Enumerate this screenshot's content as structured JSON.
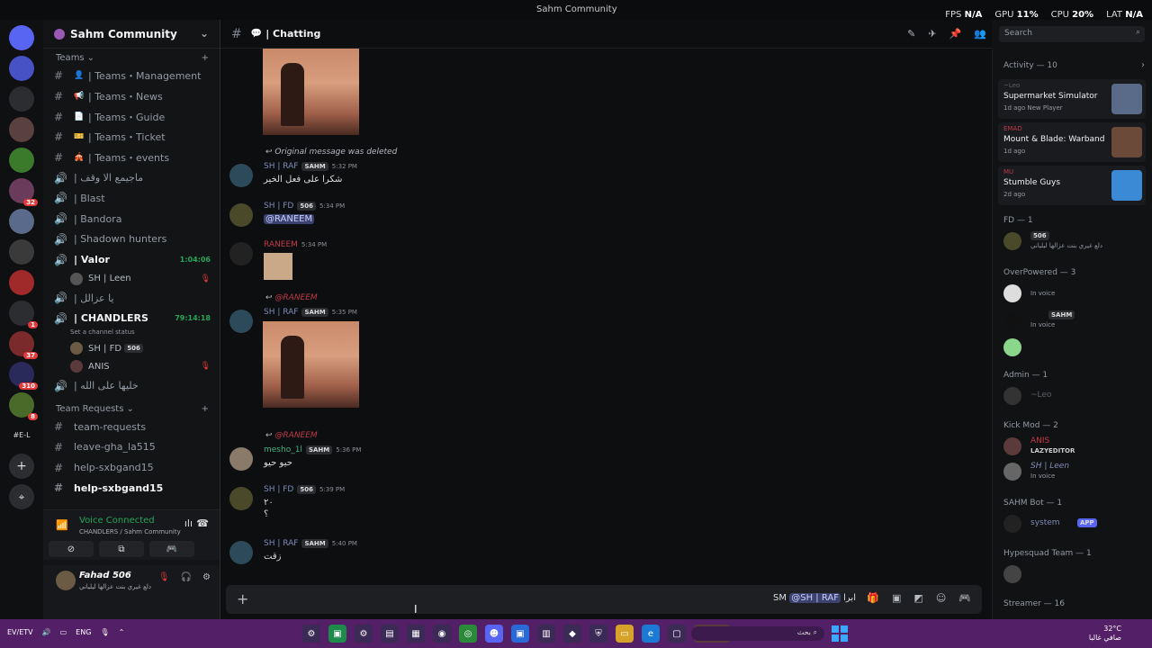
{
  "window": {
    "title": "Sahm Community",
    "fps_label": "FPS",
    "fps": "N/A",
    "gpu_label": "GPU",
    "gpu": "11%",
    "cpu_label": "CPU",
    "cpu": "20%",
    "lat_label": "LAT",
    "lat": "N/A"
  },
  "guild_badges": [
    "32",
    "1",
    "37",
    "310",
    "8"
  ],
  "guild_text": "#E-L",
  "server": {
    "name": "Sahm Community"
  },
  "channels": {
    "teams_cat": "Teams",
    "teams_items": [
      {
        "icon": "👤",
        "label": "| Teams・Management"
      },
      {
        "icon": "📢",
        "label": "| Teams・News"
      },
      {
        "icon": "📄",
        "label": "| Teams・Guide"
      },
      {
        "icon": "🎫",
        "label": "| Teams・Ticket"
      },
      {
        "icon": "🎪",
        "label": "| Teams・events"
      }
    ],
    "voice_items": [
      {
        "label": "| ماجيمع الا وقف"
      },
      {
        "label": "| Blast"
      },
      {
        "label": "| Bandora"
      },
      {
        "label": "| Shadown hunters"
      }
    ],
    "valor": {
      "label": "| Valor",
      "timer": "1:04:06"
    },
    "valor_user": "SH | Leen",
    "arabic_ch": "| يا عزالل",
    "chandlers": {
      "label": "| CHANDLERS",
      "timer": "79:14:18",
      "status": "Set a channel status"
    },
    "chandlers_users": [
      {
        "name": "SH | FD",
        "tag": "506"
      },
      {
        "name": "ANIS"
      }
    ],
    "last_voice": "| خليها على الله",
    "requests_cat": "Team Requests",
    "requests": [
      "team-requests",
      "leave-gha_la515",
      "help-sxbgand15",
      "help-sxbgand15",
      "help-sxbgand15"
    ]
  },
  "voice": {
    "status": "Voice Connected",
    "where": "CHANDLERS / Sahm Community"
  },
  "user": {
    "name": "Fahad 506",
    "status": "دلع غيري بنت عزالها ليلياني"
  },
  "chat": {
    "channel": "| Chatting",
    "deleted_note": "Original message was deleted",
    "messages": [
      {
        "author": "SH | RAF",
        "tag": "SAHM",
        "time": "5:32 PM",
        "text": "شكرا على فعل الخير"
      },
      {
        "author": "SH | FD",
        "tag": "506",
        "time": "5:34 PM",
        "text": "@RANEEM"
      },
      {
        "author": "RANEEM",
        "time": "5:34 PM",
        "text": ""
      },
      {
        "reply": "@RANEEM",
        "author": "SH | RAF",
        "tag": "SAHM",
        "time": "5:35 PM"
      },
      {
        "reply": "@RANEEM",
        "author": "mesho_1l",
        "tag": "SAHM",
        "time": "5:36 PM",
        "text": "حيو حيو"
      },
      {
        "author": "SH | FD",
        "tag": "506",
        "time": "5:39 PM",
        "text": "٢٠",
        "text2": "؟"
      },
      {
        "author": "SH | RAF",
        "tag": "SAHM",
        "time": "5:40 PM",
        "text": "زقت"
      }
    ],
    "draft_prefix": "SM",
    "draft_mention": "@SH | RAF",
    "draft_suffix": "ابرا"
  },
  "search": {
    "placeholder": "Search"
  },
  "activity": {
    "label": "Activity — 10",
    "cards": [
      {
        "user": "~Leo",
        "game": "Supermarket Simulator",
        "when": "1d ago  New Player",
        "color": "#5a6b8a"
      },
      {
        "user": "EMAD",
        "game": "Mount & Blade: Warband",
        "when": "1d ago",
        "color": "#6b4a3a"
      },
      {
        "user": "MU",
        "game": "Stumble Guys",
        "when": "2d ago",
        "color": "#3a8ad6"
      }
    ]
  },
  "roles": [
    {
      "label": "FD — 1",
      "members": [
        {
          "name": "",
          "status": "دلع غيري بنت عزالها ليلياني",
          "tag": "506"
        }
      ]
    },
    {
      "label": "OverPowered — 3",
      "members": [
        {
          "name": "",
          "status": "In voice"
        },
        {
          "name": "",
          "status": "In voice",
          "tag": "SAHM"
        },
        {
          "name": "",
          "status": ""
        }
      ]
    },
    {
      "label": "Admin — 1",
      "members": [
        {
          "name": "~Leo",
          "status": ""
        }
      ]
    },
    {
      "label": "Kick Mod — 2",
      "members": [
        {
          "name": "ANIS",
          "status": "LAZYEDITOR"
        },
        {
          "name": "SH | Leen",
          "status": "In voice"
        }
      ]
    },
    {
      "label": "SAHM Bot — 1",
      "members": [
        {
          "name": "system",
          "status": "",
          "tag": "APP"
        }
      ]
    },
    {
      "label": "Hypesquad Team — 1",
      "members": [
        {
          "name": "",
          "status": ""
        }
      ]
    },
    {
      "label": "Streamer — 16",
      "members": []
    }
  ],
  "taskbar": {
    "lang": "ENG",
    "left": "EV/ETV",
    "search": "بحث",
    "weather": "32°C",
    "weather_sub": "صافي غالبا"
  }
}
